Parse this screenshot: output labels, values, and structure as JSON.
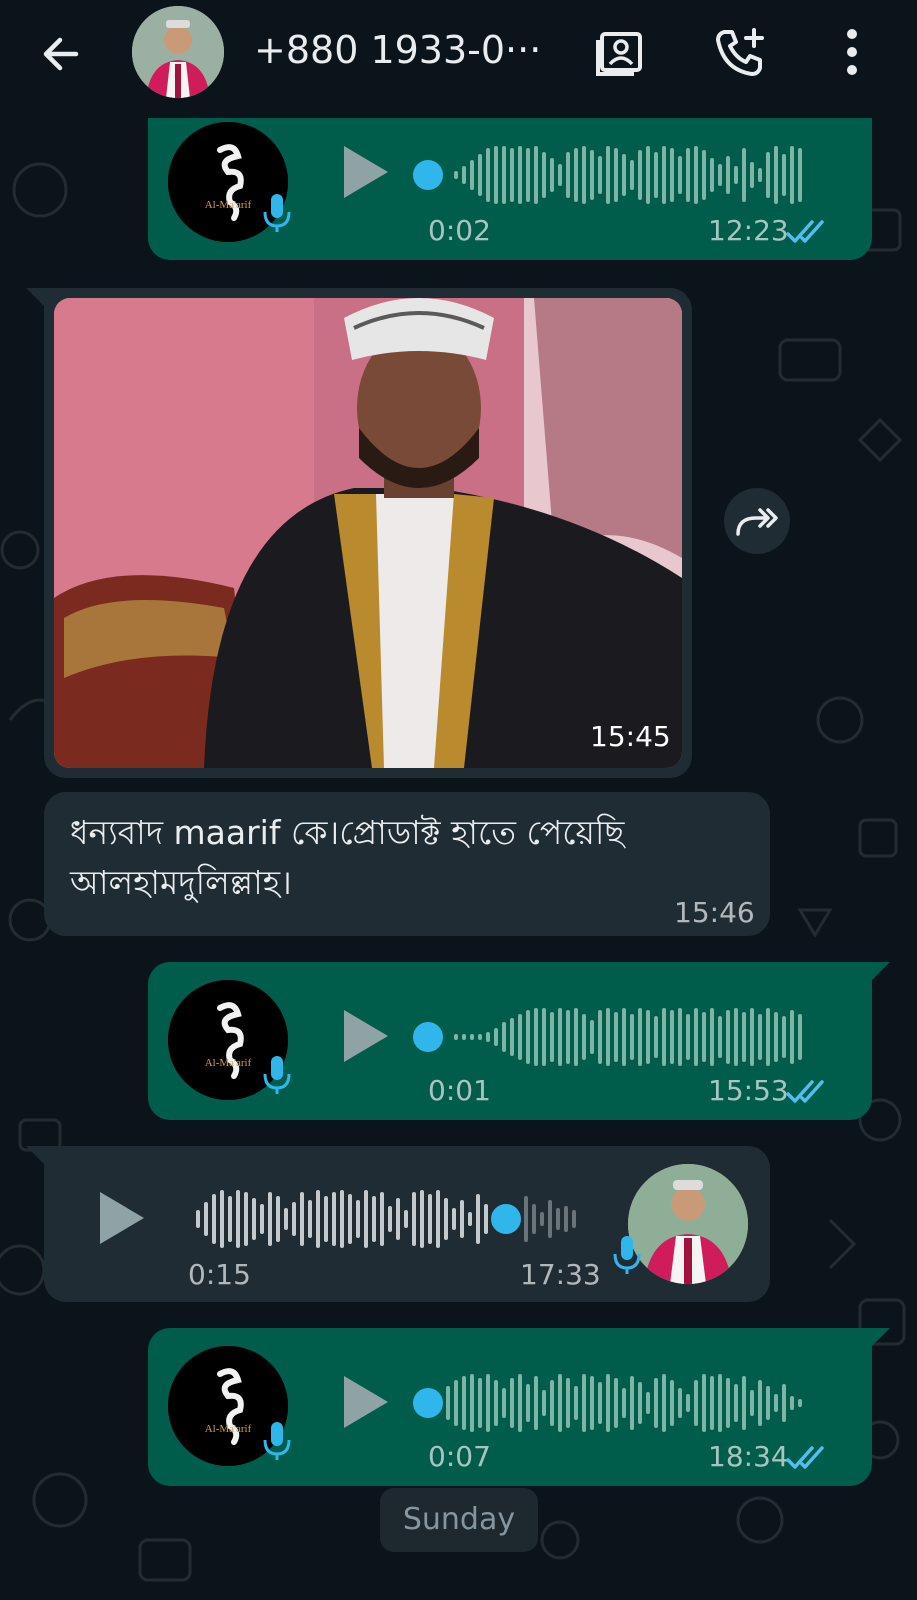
{
  "header": {
    "contact_name": "+880 1933-0···"
  },
  "messages": [
    {
      "kind": "voice",
      "direction": "outgoing",
      "avatar_brand": "Al-Ma'arif",
      "duration": "0:02",
      "time": "12:23",
      "status": "read"
    },
    {
      "kind": "image",
      "direction": "incoming",
      "time": "15:45"
    },
    {
      "kind": "text",
      "direction": "incoming",
      "text": "ধন্যবাদ maarif কে।প্রোডাক্ট হাতে পেয়েছি আলহামদুলিল্লাহ।",
      "time": "15:46"
    },
    {
      "kind": "voice",
      "direction": "outgoing",
      "avatar_brand": "Al-Ma'arif",
      "duration": "0:01",
      "time": "15:53",
      "status": "read"
    },
    {
      "kind": "voice",
      "direction": "incoming",
      "duration": "0:15",
      "time": "17:33",
      "progress": 0.78
    },
    {
      "kind": "voice",
      "direction": "outgoing",
      "avatar_brand": "Al-Ma'arif",
      "duration": "0:07",
      "time": "18:34",
      "status": "read"
    }
  ],
  "date_separator": "Sunday",
  "colors": {
    "background": "#0b141a",
    "outgoing_bubble": "#005c4b",
    "incoming_bubble": "#202c33",
    "accent_blue": "#2fb6ea",
    "read_ticks": "#53bdeb"
  }
}
